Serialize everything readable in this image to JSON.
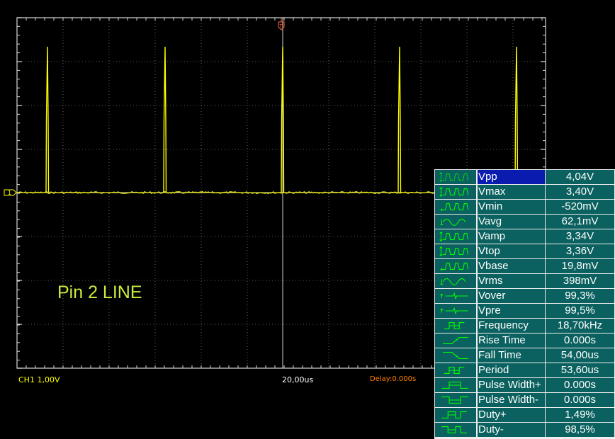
{
  "scope": {
    "status_bar": {
      "channel": "CH1 1,00V",
      "timebase": "20,00us",
      "delay": "Delay:0.000s"
    },
    "channel_marker": "1",
    "trigger_marker": "T",
    "annotation": "Pin 2 LINE",
    "colors": {
      "trace": "#ffff00",
      "grid": "#e0e0e0",
      "channel": "#ffff00",
      "delay": "#ff8000",
      "annotation": "#c8ec3c",
      "table_bg": "#0a615f",
      "table_selected": "#0a1bb0",
      "icon": "#00ff00"
    }
  },
  "measurements": [
    {
      "icon": "vpp-icon",
      "name": "Vpp",
      "value": "4,04V",
      "selected": true
    },
    {
      "icon": "vmax-icon",
      "name": "Vmax",
      "value": "3,40V"
    },
    {
      "icon": "vmin-icon",
      "name": "Vmin",
      "value": "-520mV"
    },
    {
      "icon": "vavg-icon",
      "name": "Vavg",
      "value": "62,1mV"
    },
    {
      "icon": "vamp-icon",
      "name": "Vamp",
      "value": "3,34V"
    },
    {
      "icon": "vtop-icon",
      "name": "Vtop",
      "value": "3,36V"
    },
    {
      "icon": "vbase-icon",
      "name": "Vbase",
      "value": "19,8mV"
    },
    {
      "icon": "vrms-icon",
      "name": "Vrms",
      "value": "398mV"
    },
    {
      "icon": "vover-icon",
      "name": "Vover",
      "value": "99,3%"
    },
    {
      "icon": "vpre-icon",
      "name": "Vpre",
      "value": "99,5%"
    },
    {
      "icon": "frequency-icon",
      "name": "Frequency",
      "value": "18,70kHz"
    },
    {
      "icon": "rise-time-icon",
      "name": "Rise Time",
      "value": "0.000s"
    },
    {
      "icon": "fall-time-icon",
      "name": "Fall Time",
      "value": "54,00us"
    },
    {
      "icon": "period-icon",
      "name": "Period",
      "value": "53,60us"
    },
    {
      "icon": "pulse-width-plus-icon",
      "name": "Pulse Width+",
      "value": "0.000s"
    },
    {
      "icon": "pulse-width-minus-icon",
      "name": "Pulse Width-",
      "value": "0.000s"
    },
    {
      "icon": "duty-plus-icon",
      "name": "Duty+",
      "value": "1,49%"
    },
    {
      "icon": "duty-minus-icon",
      "name": "Duty-",
      "value": "98,5%"
    }
  ]
}
